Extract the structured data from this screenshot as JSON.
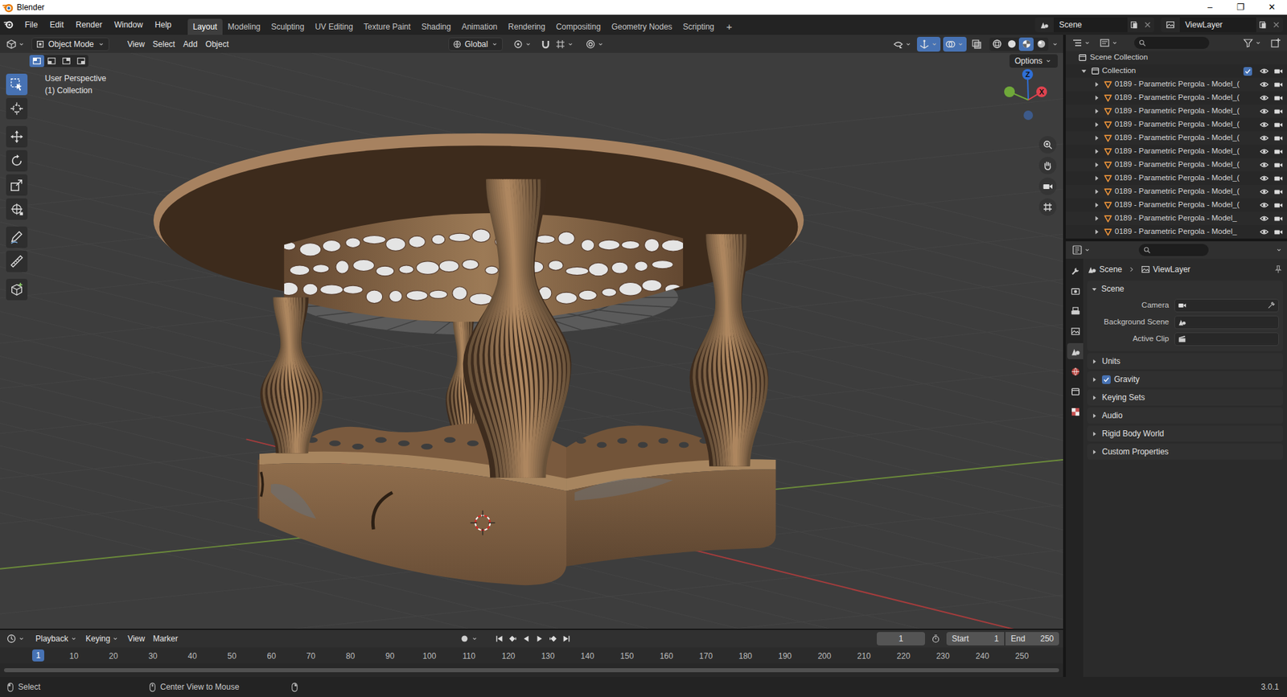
{
  "window": {
    "title": "Blender",
    "controls": [
      "–",
      "❐",
      "✕"
    ]
  },
  "topbar": {
    "menus": [
      "File",
      "Edit",
      "Render",
      "Window",
      "Help"
    ],
    "workspaces": [
      {
        "label": "Layout",
        "selected": true
      },
      {
        "label": "Modeling",
        "selected": false
      },
      {
        "label": "Sculpting",
        "selected": false
      },
      {
        "label": "UV Editing",
        "selected": false
      },
      {
        "label": "Texture Paint",
        "selected": false
      },
      {
        "label": "Shading",
        "selected": false
      },
      {
        "label": "Animation",
        "selected": false
      },
      {
        "label": "Rendering",
        "selected": false
      },
      {
        "label": "Compositing",
        "selected": false
      },
      {
        "label": "Geometry Nodes",
        "selected": false
      },
      {
        "label": "Scripting",
        "selected": false
      }
    ],
    "add_workspace": "+",
    "scene": "Scene",
    "view_layer": "ViewLayer"
  },
  "viewport": {
    "mode": "Object Mode",
    "menus": [
      "View",
      "Select",
      "Add",
      "Object"
    ],
    "orientation": "Global",
    "options": "Options",
    "selection_modes": [
      {
        "selected": true
      },
      {
        "selected": false
      },
      {
        "selected": false
      },
      {
        "selected": false
      }
    ],
    "toggles": [
      {
        "kind": "visibility",
        "on": false
      },
      {
        "kind": "gizmo",
        "on": true
      },
      {
        "kind": "overlay",
        "on": true
      },
      {
        "kind": "xray",
        "on": false
      }
    ],
    "shading": [
      {
        "kind": "wireframe",
        "selected": false
      },
      {
        "kind": "solid",
        "selected": false
      },
      {
        "kind": "material",
        "selected": true
      },
      {
        "kind": "rendered",
        "selected": false
      }
    ],
    "info": [
      "User Perspective",
      "(1) Collection"
    ],
    "gizmo": {
      "z": "Z",
      "x": "X"
    },
    "tools": [
      {
        "kind": "select",
        "selected": true
      },
      {
        "kind": "cursor",
        "selected": false
      },
      {
        "kind": "move",
        "selected": false
      },
      {
        "kind": "rotate",
        "selected": false
      },
      {
        "kind": "scale",
        "selected": false
      },
      {
        "kind": "transform",
        "selected": false
      },
      {
        "kind": "annotate",
        "selected": false
      },
      {
        "kind": "measure",
        "selected": false
      },
      {
        "kind": "add-cube",
        "selected": false
      }
    ]
  },
  "outliner": {
    "root": "Scene Collection",
    "collection": {
      "label": "Collection",
      "expanded": true,
      "checked": true,
      "visible": true,
      "renderable": true
    },
    "items": [
      {
        "label": "0189 - Parametric Pergola - Model_(",
        "expanded": false,
        "visible": true,
        "renderable": true
      },
      {
        "label": "0189 - Parametric Pergola - Model_(",
        "expanded": false,
        "visible": true,
        "renderable": true
      },
      {
        "label": "0189 - Parametric Pergola - Model_(",
        "expanded": false,
        "visible": true,
        "renderable": true
      },
      {
        "label": "0189 - Parametric Pergola - Model_(",
        "expanded": false,
        "visible": true,
        "renderable": true
      },
      {
        "label": "0189 - Parametric Pergola - Model_(",
        "expanded": false,
        "visible": true,
        "renderable": true
      },
      {
        "label": "0189 - Parametric Pergola - Model_(",
        "expanded": false,
        "visible": true,
        "renderable": true
      },
      {
        "label": "0189 - Parametric Pergola - Model_(",
        "expanded": false,
        "visible": true,
        "renderable": true
      },
      {
        "label": "0189 - Parametric Pergola - Model_(",
        "expanded": false,
        "visible": true,
        "renderable": true
      },
      {
        "label": "0189 - Parametric Pergola - Model_(",
        "expanded": false,
        "visible": true,
        "renderable": true
      },
      {
        "label": "0189 - Parametric Pergola - Model_(",
        "expanded": false,
        "visible": true,
        "renderable": true
      },
      {
        "label": "0189 - Parametric Pergola - Model_",
        "expanded": false,
        "visible": true,
        "renderable": true
      },
      {
        "label": "0189 - Parametric Pergola - Model_",
        "expanded": false,
        "visible": true,
        "renderable": true
      }
    ]
  },
  "properties": {
    "breadcrumb": [
      "Scene",
      "ViewLayer"
    ],
    "tabs": [
      {
        "kind": "tool",
        "selected": false
      },
      {
        "kind": "render",
        "selected": false
      },
      {
        "kind": "output",
        "selected": false
      },
      {
        "kind": "view-layer",
        "selected": false
      },
      {
        "kind": "scene",
        "selected": true
      },
      {
        "kind": "world",
        "selected": false
      },
      {
        "kind": "collection",
        "selected": false
      },
      {
        "kind": "texture",
        "selected": false
      }
    ],
    "panel": {
      "title": "Scene",
      "expanded": true,
      "fields": [
        {
          "label": "Camera",
          "kind": "camera"
        },
        {
          "label": "Background Scene",
          "kind": "scene"
        },
        {
          "label": "Active Clip",
          "kind": "clip"
        }
      ]
    },
    "sections": [
      {
        "label": "Units",
        "kind": "plain",
        "expanded": false
      },
      {
        "label": "Gravity",
        "kind": "checkbox",
        "checked": true,
        "expanded": false
      },
      {
        "label": "Keying Sets",
        "kind": "plain",
        "expanded": false
      },
      {
        "label": "Audio",
        "kind": "plain",
        "expanded": false
      },
      {
        "label": "Rigid Body World",
        "kind": "plain",
        "expanded": false
      },
      {
        "label": "Custom Properties",
        "kind": "plain",
        "expanded": false
      }
    ]
  },
  "timeline": {
    "menus": [
      "Playback",
      "Keying",
      "View",
      "Marker"
    ],
    "frame": "1",
    "start_label": "Start",
    "start": "1",
    "end_label": "End",
    "end": "250",
    "playhead": "1",
    "ticks": [
      "10",
      "20",
      "30",
      "40",
      "50",
      "60",
      "70",
      "80",
      "90",
      "100",
      "110",
      "120",
      "130",
      "140",
      "150",
      "160",
      "170",
      "180",
      "190",
      "200",
      "210",
      "220",
      "230",
      "240",
      "250"
    ]
  },
  "status_bar": {
    "items": [
      "Select",
      "Center View to Mouse"
    ],
    "version": "3.0.1"
  }
}
